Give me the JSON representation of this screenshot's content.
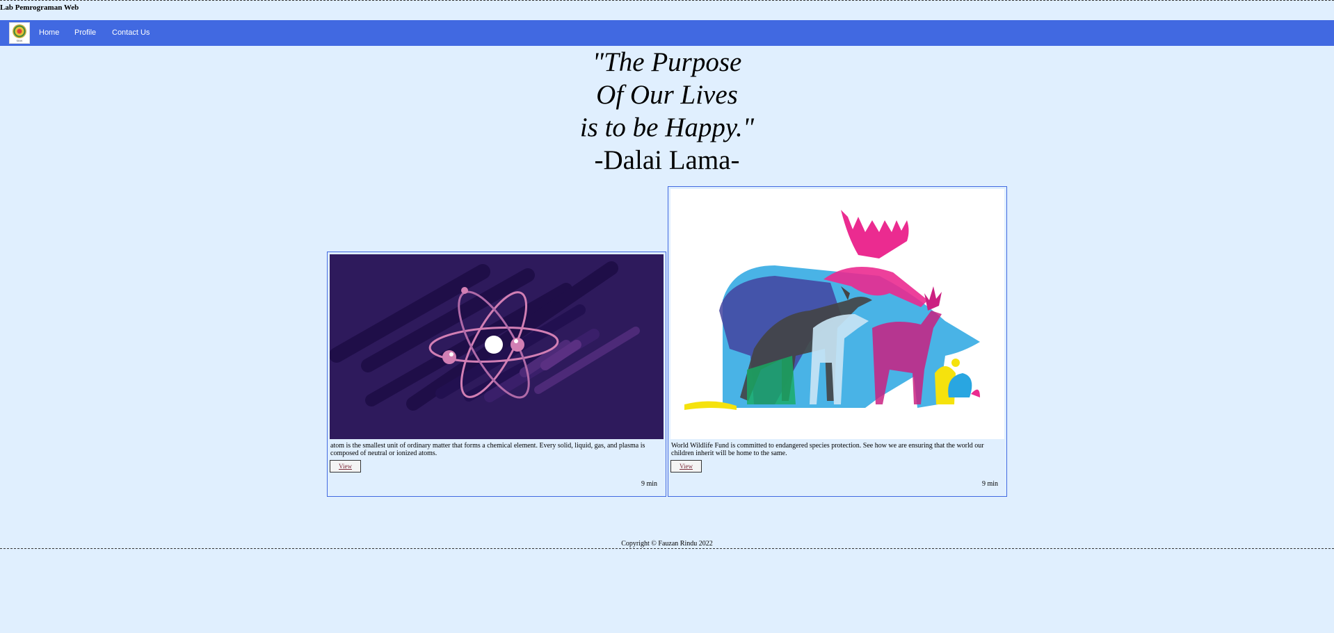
{
  "header": {
    "site_title": "Lab Pemrograman Web"
  },
  "navbar": {
    "logo_text": "SBIK",
    "links": [
      {
        "label": "Home"
      },
      {
        "label": "Profile"
      },
      {
        "label": "Contact Us"
      }
    ]
  },
  "quote": {
    "lines": [
      "\"The Purpose",
      "Of Our Lives",
      "is to be Happy.\""
    ],
    "author": "-Dalai Lama-"
  },
  "cards": [
    {
      "description": "atom is the smallest unit of ordinary matter that forms a chemical element. Every solid, liquid, gas, and plasma is composed of neutral or ionized atoms.",
      "button_label": "View",
      "time": "9 min",
      "image": "atom-illustration"
    },
    {
      "description": "World Wildlife Fund is committed to endangered species protection. See how we are ensuring that the world our children inherit will be home to the same.",
      "button_label": "View",
      "time": "9 min",
      "image": "wildlife-animals-illustration"
    }
  ],
  "footer": {
    "copyright": "Copyright © Fauzan Rindu 2022"
  },
  "colors": {
    "background": "#e0effe",
    "navbar": "#4169e1",
    "card_border": "#4169e1"
  }
}
